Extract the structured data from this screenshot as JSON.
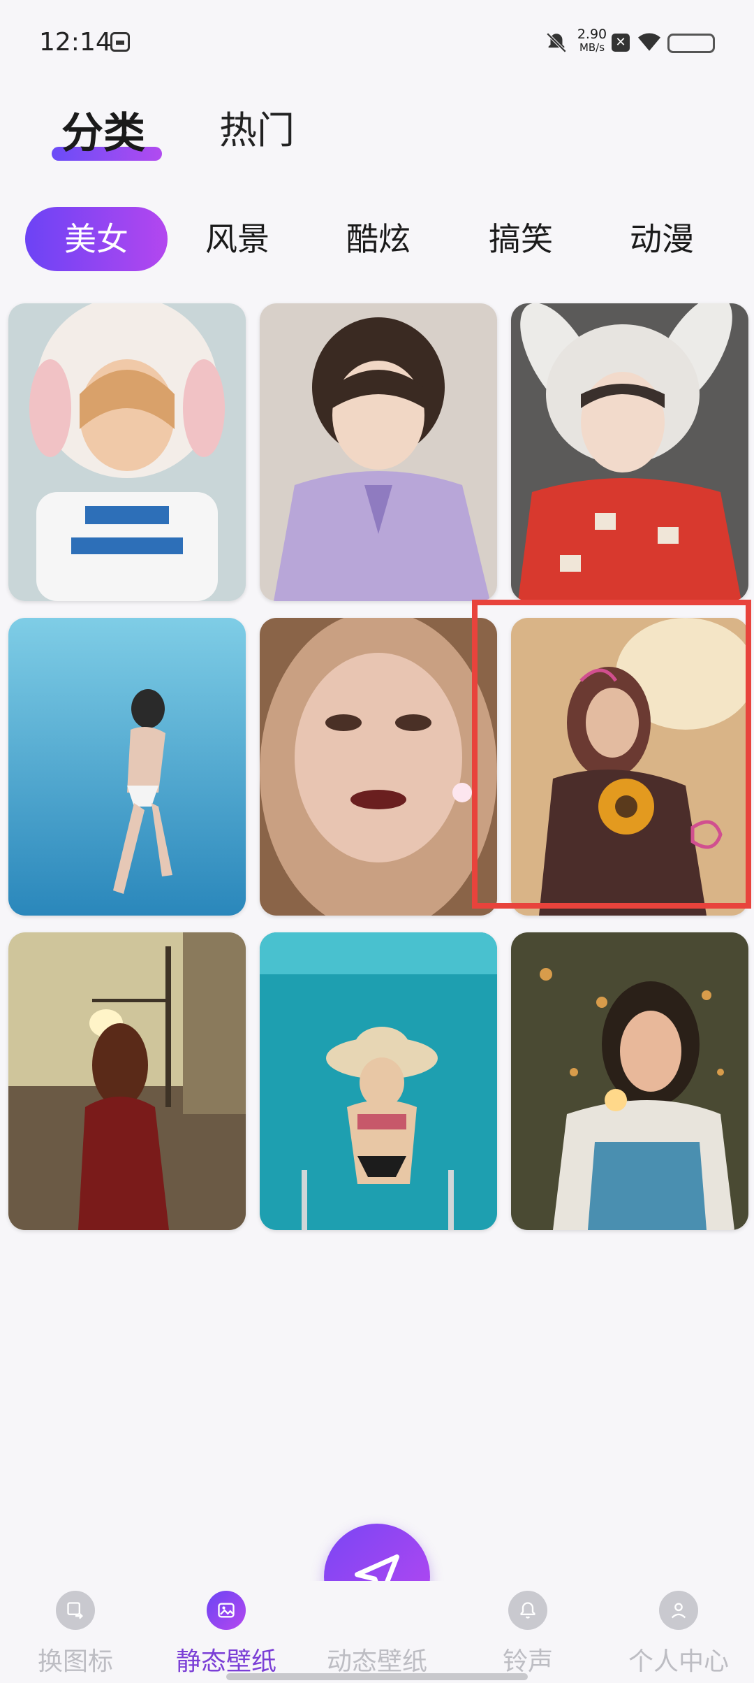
{
  "status_bar": {
    "time": "12:14",
    "net_speed_value": "2.90",
    "net_speed_unit": "MB/s",
    "icons": [
      "sim-icon",
      "bell-muted-icon",
      "close-box-icon",
      "wifi-icon",
      "battery-icon"
    ]
  },
  "header": {
    "tabs": [
      {
        "label": "分类",
        "active": true
      },
      {
        "label": "热门",
        "active": false
      }
    ]
  },
  "categories": [
    {
      "label": "美女",
      "active": true
    },
    {
      "label": "风景",
      "active": false
    },
    {
      "label": "酷炫",
      "active": false
    },
    {
      "label": "搞笑",
      "active": false
    },
    {
      "label": "动漫",
      "active": false
    }
  ],
  "wallpapers": [
    {
      "name": "girl-bunny-hat-white-shirt",
      "palette": [
        "#c9d6d8",
        "#f3ede8",
        "#f0c9a8",
        "#2d6fb8"
      ]
    },
    {
      "name": "girl-kimono",
      "palette": [
        "#d8d0c9",
        "#b8a6d8",
        "#f1d7c5",
        "#3a2a22"
      ]
    },
    {
      "name": "girl-bunny-hat-red-shirt",
      "palette": [
        "#5b5a59",
        "#e7e4e0",
        "#d8392e",
        "#f2dacb"
      ]
    },
    {
      "name": "underwater-swimmer",
      "palette": [
        "#3fa2d4",
        "#7fcde6",
        "#2a87bb",
        "#e6c8b6"
      ]
    },
    {
      "name": "portrait-closeup",
      "palette": [
        "#8a6448",
        "#c9a082",
        "#6a1f1f",
        "#e8c5b2"
      ]
    },
    {
      "name": "girl-sunflower",
      "palette": [
        "#d9b487",
        "#6b3a32",
        "#e39a1f",
        "#d14f8f"
      ]
    },
    {
      "name": "girl-sunset-street",
      "palette": [
        "#cfc59b",
        "#6b5a45",
        "#7a1b1a",
        "#3e3326"
      ]
    },
    {
      "name": "girl-pool-hat",
      "palette": [
        "#1e9fb0",
        "#49c1cf",
        "#e8c7a5",
        "#1c1c1c"
      ]
    },
    {
      "name": "girl-sparkler",
      "palette": [
        "#4a4a33",
        "#d89c4b",
        "#4a8fb0",
        "#e8b89a"
      ]
    }
  ],
  "bottom_nav": {
    "items": [
      {
        "label": "换图标",
        "icon": "swap-icon",
        "active": false
      },
      {
        "label": "静态壁纸",
        "icon": "image-icon",
        "active": true
      },
      {
        "label": "动态壁纸",
        "icon": "send-icon",
        "active": false
      },
      {
        "label": "铃声",
        "icon": "bell-icon",
        "active": false
      },
      {
        "label": "个人中心",
        "icon": "person-icon",
        "active": false
      }
    ]
  },
  "colors": {
    "accent_start": "#6c43f5",
    "accent_end": "#b347ef",
    "highlight_box": "#e8433c"
  }
}
